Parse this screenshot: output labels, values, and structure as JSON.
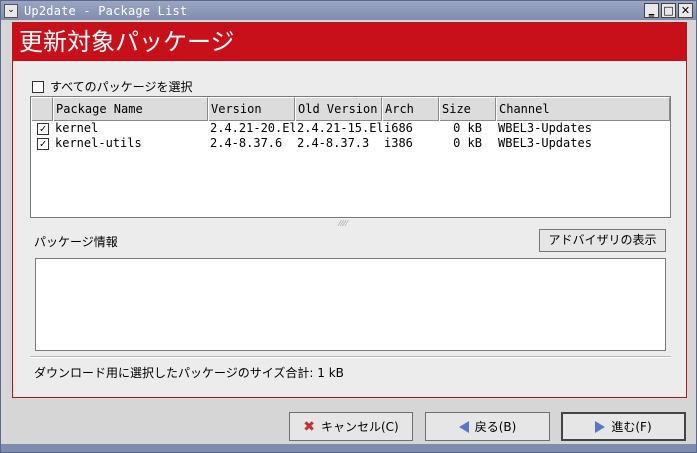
{
  "window": {
    "title": "Up2date - Package List",
    "menu_glyph": "⌄",
    "minimize_glyph": "‗",
    "maximize_glyph": "□",
    "close_glyph": "✕"
  },
  "banner": {
    "title": "更新対象パッケージ"
  },
  "select_all": {
    "label": "すべてのパッケージを選択",
    "checked": false
  },
  "table": {
    "headers": [
      "",
      "Package Name",
      "Version",
      "Old Version",
      "Arch",
      "Size",
      "Channel"
    ],
    "rows": [
      {
        "checked": true,
        "check_glyph": "✓",
        "name": "kernel",
        "version": "2.4.21-20.El",
        "old_version": "2.4.21-15.El",
        "arch": "i686",
        "size": "0 kB",
        "channel": "WBEL3-Updates"
      },
      {
        "checked": true,
        "check_glyph": "✓",
        "name": "kernel-utils",
        "version": "2.4-8.37.6",
        "old_version": "2.4-8.37.3",
        "arch": "i386",
        "size": "0 kB",
        "channel": "WBEL3-Updates"
      }
    ]
  },
  "info": {
    "label": "パッケージ情報",
    "advisory_button": "アドバイザリの表示",
    "text": ""
  },
  "summary": {
    "text": "ダウンロード用に選択したパッケージのサイズ合計: 1 kB"
  },
  "buttons": {
    "cancel": "キャンセル(C)",
    "back": "戻る(B)",
    "forward": "進む(F)"
  },
  "icons": {
    "cancel": "cancel-x-icon",
    "back": "back-arrow-icon",
    "forward": "forward-arrow-icon"
  },
  "colors": {
    "banner": "#c8101b",
    "titlebar": "#8a97b8",
    "arrow": "#5a78c9",
    "cancel_icon": "#c4302b"
  }
}
